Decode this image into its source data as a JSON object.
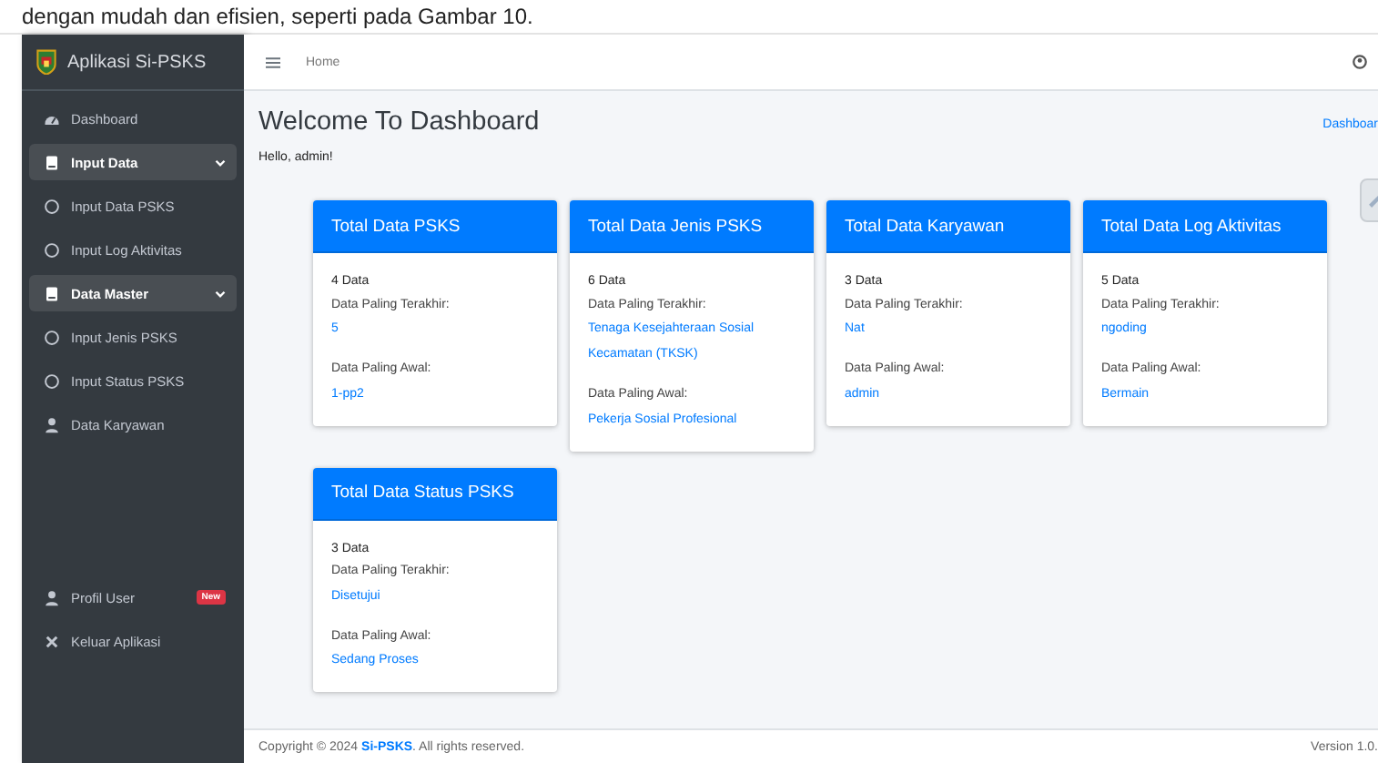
{
  "document_text": "dengan mudah dan efisien, seperti pada Gambar 10.",
  "brand": "Aplikasi Si-PSKS",
  "menu": [
    {
      "kind": "dashboard",
      "label": "Dashboard"
    },
    {
      "kind": "section",
      "label": "Input Data",
      "expanded": true
    },
    {
      "kind": "sub",
      "label": "Input Data PSKS"
    },
    {
      "kind": "sub",
      "label": "Input Log Aktivitas"
    },
    {
      "kind": "section",
      "label": "Data Master",
      "expanded": true
    },
    {
      "kind": "sub",
      "label": "Input Jenis PSKS"
    },
    {
      "kind": "sub",
      "label": "Input Status PSKS"
    },
    {
      "kind": "person",
      "label": "Data Karyawan"
    }
  ],
  "bottom_menu": [
    {
      "kind": "person",
      "label": "Profil User",
      "badge": "New"
    },
    {
      "kind": "exit",
      "label": "Keluar Aplikasi"
    }
  ],
  "header": {
    "breadcrumb": "Home"
  },
  "page_title": "Welcome To Dashboard",
  "greeting": "Hello, admin!",
  "breadcrumb_right": "Dashboar",
  "cards": [
    {
      "title": "Total Data PSKS",
      "count": "4 Data",
      "latest_label": "Data Paling Terakhir:",
      "latest_value": "5",
      "earliest_label": "Data Paling Awal:",
      "earliest_value": "1-pp2"
    },
    {
      "title": "Total Data Jenis PSKS",
      "count": "6 Data",
      "latest_label": "Data Paling Terakhir:",
      "latest_value": "Tenaga Kesejahteraan Sosial Kecamatan (TKSK)",
      "earliest_label": "Data Paling Awal:",
      "earliest_value": "Pekerja Sosial Profesional"
    },
    {
      "title": "Total Data Karyawan",
      "count": "3 Data",
      "latest_label": "Data Paling Terakhir:",
      "latest_value": "Nat",
      "earliest_label": "Data Paling Awal:",
      "earliest_value": "admin"
    },
    {
      "title": "Total Data Log Aktivitas",
      "count": "5 Data",
      "latest_label": "Data Paling Terakhir:",
      "latest_value": "ngoding",
      "earliest_label": "Data Paling Awal:",
      "earliest_value": "Bermain"
    },
    {
      "title": "Total Data Status PSKS",
      "count": "3 Data",
      "latest_label": "Data Paling Terakhir:",
      "latest_value": "Disetujui",
      "earliest_label": "Data Paling Awal:",
      "earliest_value": "Sedang Proses"
    }
  ],
  "footer": {
    "copyright": "Copyright © 2024 **Si-PSKS**. All rights reserved.",
    "version": "Version 1.0."
  }
}
